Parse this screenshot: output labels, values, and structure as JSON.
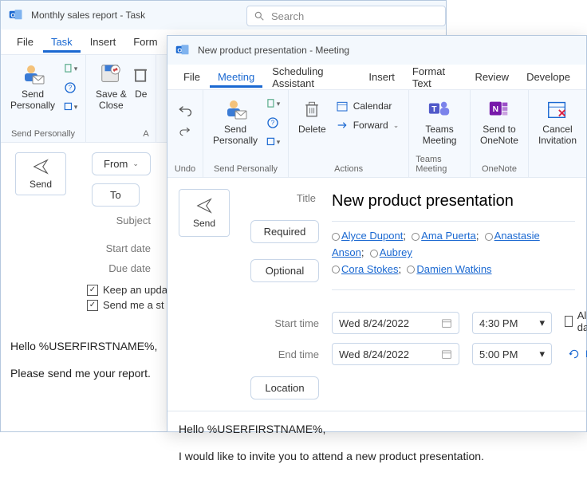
{
  "search": {
    "placeholder": "Search"
  },
  "win1": {
    "title": "Monthly sales report  -  Task",
    "menu": {
      "file": "File",
      "task": "Task",
      "insert": "Insert",
      "format": "Form"
    },
    "ribbon": {
      "send_personally": "Send\nPersonally",
      "send_personally_group": "Send Personally",
      "save_close": "Save &\nClose",
      "delete_trunc": "De",
      "actions_trunc": "A"
    },
    "compose": {
      "send": "Send",
      "from": "From",
      "to": "To",
      "subject": "Subject",
      "start_date": "Start date",
      "due_date": "Due date",
      "keep_updated": "Keep an upda",
      "send_status": "Send me a st"
    },
    "body": {
      "l1": "Hello %USERFIRSTNAME%,",
      "l2": "Please send me your report."
    }
  },
  "win2": {
    "title": "New product presentation  -  Meeting",
    "menu": {
      "file": "File",
      "meeting": "Meeting",
      "sched": "Scheduling Assistant",
      "insert": "Insert",
      "format": "Format Text",
      "review": "Review",
      "developer": "Develope"
    },
    "ribbon": {
      "undo": "Undo",
      "send_personally": "Send\nPersonally",
      "send_personally_group": "Send Personally",
      "delete": "Delete",
      "calendar": "Calendar",
      "forward": "Forward",
      "actions": "Actions",
      "teams": "Teams\nMeeting",
      "teams_group": "Teams Meeting",
      "onenote": "Send to\nOneNote",
      "onenote_group": "OneNote",
      "cancel": "Cancel\nInvitation"
    },
    "compose": {
      "send": "Send",
      "title_label": "Title",
      "title_value": "New product presentation",
      "required": "Required",
      "optional": "Optional",
      "recipients": [
        "Alyce Dupont",
        "Ama Puerta",
        "Anastasie Anson",
        "Aubrey",
        "Cora Stokes",
        "Damien Watkins"
      ],
      "start_label": "Start time",
      "end_label": "End time",
      "start_date": "Wed 8/24/2022",
      "end_date": "Wed 8/24/2022",
      "start_time": "4:30 PM",
      "end_time": "5:00 PM",
      "all_day": "All day",
      "make": "Make",
      "location": "Location"
    },
    "body": {
      "l1": "Hello %USERFIRSTNAME%,",
      "l2": "I would like to invite you to attend a new product presentation."
    }
  }
}
